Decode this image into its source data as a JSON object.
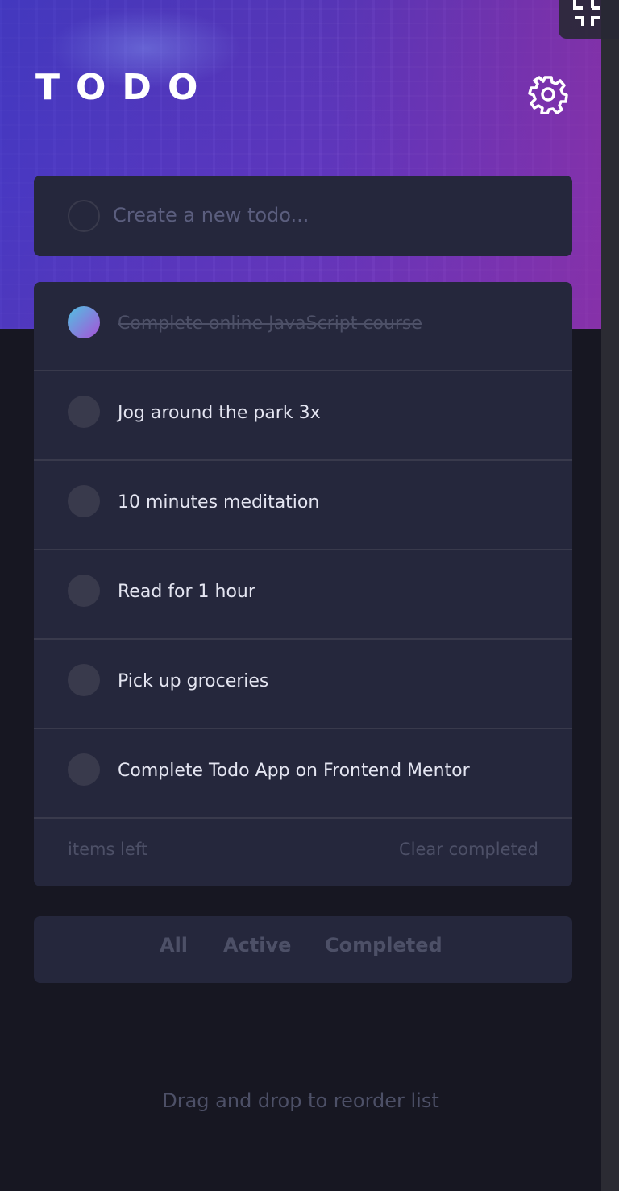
{
  "header": {
    "title": "TODO",
    "settings_icon": "gear-icon",
    "fullscreen_icon": "fullscreen-exit-icon"
  },
  "new_todo": {
    "placeholder": "Create a new todo...",
    "value": ""
  },
  "todos": [
    {
      "text": "Complete online JavaScript course",
      "completed": true
    },
    {
      "text": "Jog around the park 3x",
      "completed": false
    },
    {
      "text": "10 minutes meditation",
      "completed": false
    },
    {
      "text": "Read for 1 hour",
      "completed": false
    },
    {
      "text": "Pick up groceries",
      "completed": false
    },
    {
      "text": "Complete Todo App on Frontend Mentor",
      "completed": false
    }
  ],
  "footer": {
    "items_left": "items left",
    "clear_completed": "Clear completed"
  },
  "filters": [
    "All",
    "Active",
    "Completed"
  ],
  "hint": "Drag and drop to reorder list",
  "colors": {
    "background": "#171722",
    "card": "#25273c",
    "divider": "#393a4c",
    "text": "#e4e5f1",
    "muted": "#4d5067",
    "check_gradient_start": "#57ddff",
    "check_gradient_end": "#c058f3"
  }
}
